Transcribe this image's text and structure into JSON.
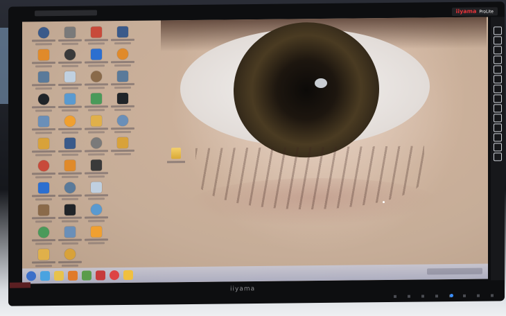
{
  "monitor": {
    "brand": "iiyama",
    "badge_brand": "iiyama",
    "badge_sub": "ProLite"
  },
  "desktop": {
    "icon_count": 38,
    "folder_label": "",
    "wallpaper": "close-up human eye"
  },
  "colors": {
    "bezel": "#0d0e10",
    "skin": "#cbb09a",
    "iris": "#4a3b22",
    "taskbar": "#aab0c8",
    "brand_red": "#e8343a",
    "led": "#3a8fff"
  }
}
